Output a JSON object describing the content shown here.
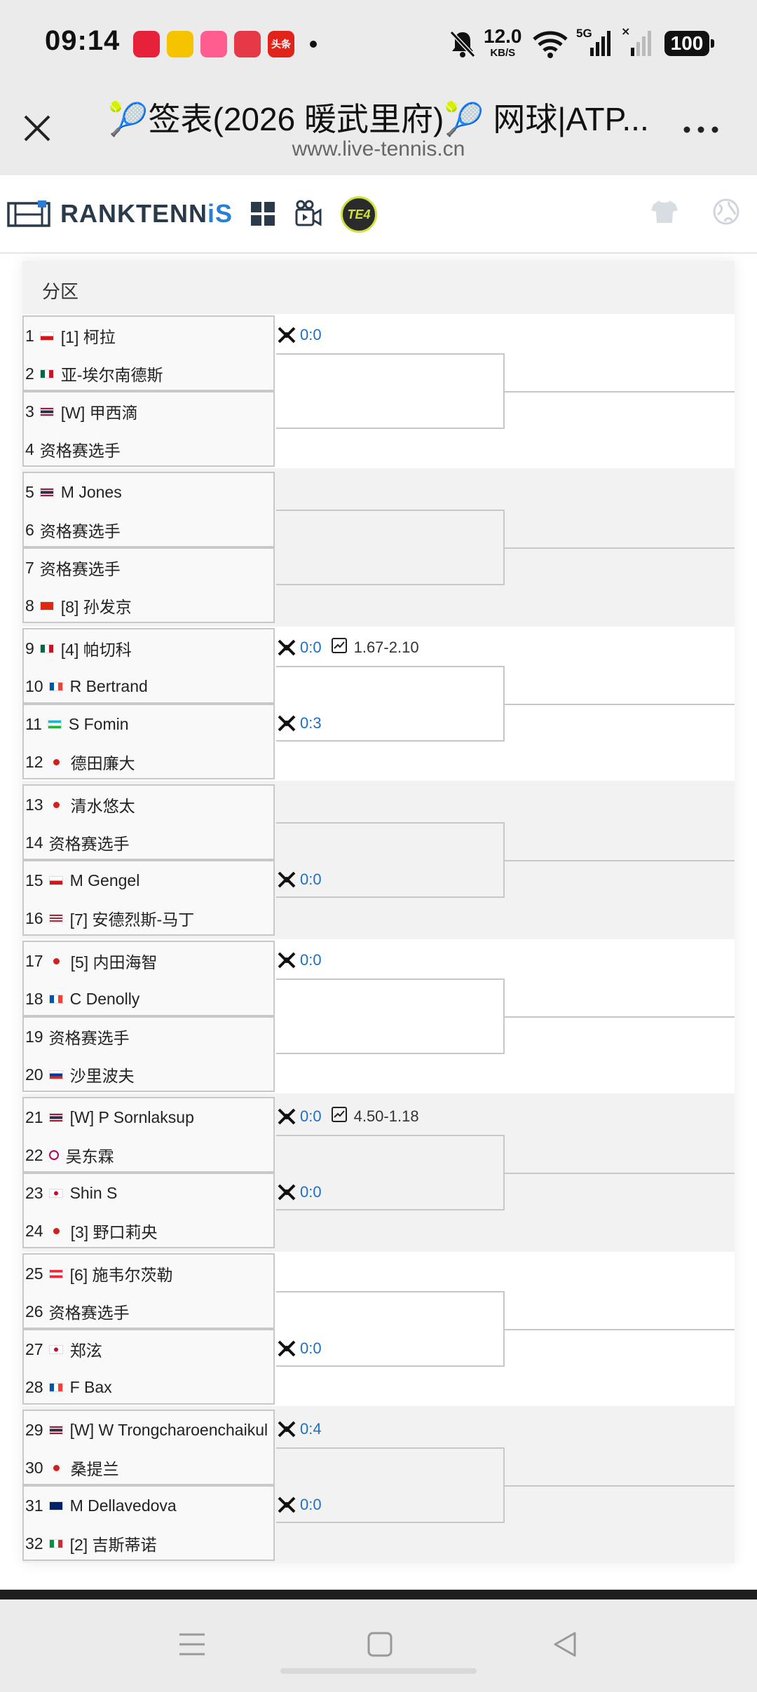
{
  "status_bar": {
    "time": "09:14",
    "net_speed_value": "12.0",
    "net_speed_unit": "KB/S",
    "network_type": "5G",
    "battery": "100",
    "app_icons": [
      {
        "name": "app-icon-red",
        "label": "",
        "color": "#e8213a"
      },
      {
        "name": "weibo-icon",
        "label": "",
        "color": "#f5c400"
      },
      {
        "name": "app-icon-pink",
        "label": "",
        "color": "#ff5d8f"
      },
      {
        "name": "app-icon-mascot",
        "label": "",
        "color": "#e63946"
      },
      {
        "name": "toutiao-icon",
        "label": "头条",
        "color": "#e2231a"
      }
    ]
  },
  "browser": {
    "title": "🎾签表(2026 暖武里府)🎾 网球|ATP...",
    "url": "www.live-tennis.cn"
  },
  "site": {
    "logo_main": "RANKTENN",
    "logo_accent": "iS",
    "badge": "TE4"
  },
  "bracket": {
    "section_label": "分区",
    "players": [
      {
        "num": "1",
        "flag": "cz",
        "name": "[1] 柯拉"
      },
      {
        "num": "2",
        "flag": "mx",
        "name": "亚-埃尔南德斯"
      },
      {
        "num": "3",
        "flag": "th",
        "name": "[W] 甲西滴"
      },
      {
        "num": "4",
        "flag": "",
        "name": "资格赛选手"
      },
      {
        "num": "5",
        "flag": "th",
        "name": "M Jones"
      },
      {
        "num": "6",
        "flag": "",
        "name": "资格赛选手"
      },
      {
        "num": "7",
        "flag": "",
        "name": "资格赛选手"
      },
      {
        "num": "8",
        "flag": "cn",
        "name": "[8] 孙发京"
      },
      {
        "num": "9",
        "flag": "mx",
        "name": "[4] 帕切科"
      },
      {
        "num": "10",
        "flag": "fr",
        "name": "R Bertrand"
      },
      {
        "num": "11",
        "flag": "uz",
        "name": "S Fomin"
      },
      {
        "num": "12",
        "flag": "jp",
        "name": "德田廉大"
      },
      {
        "num": "13",
        "flag": "jp",
        "name": "清水悠太"
      },
      {
        "num": "14",
        "flag": "",
        "name": "资格赛选手"
      },
      {
        "num": "15",
        "flag": "cz",
        "name": "M Gengel"
      },
      {
        "num": "16",
        "flag": "us",
        "name": "[7] 安德烈斯-马丁"
      },
      {
        "num": "17",
        "flag": "jp",
        "name": "[5] 内田海智"
      },
      {
        "num": "18",
        "flag": "fr",
        "name": "C Denolly"
      },
      {
        "num": "19",
        "flag": "",
        "name": "资格赛选手"
      },
      {
        "num": "20",
        "flag": "ru",
        "name": "沙里波夫"
      },
      {
        "num": "21",
        "flag": "th",
        "name": "[W] P Sornlaksup"
      },
      {
        "num": "22",
        "flag": "tw",
        "name": "吴东霖"
      },
      {
        "num": "23",
        "flag": "kr",
        "name": "Shin S"
      },
      {
        "num": "24",
        "flag": "jp",
        "name": "[3] 野口莉央"
      },
      {
        "num": "25",
        "flag": "at",
        "name": "[6] 施韦尔茨勒"
      },
      {
        "num": "26",
        "flag": "",
        "name": "资格赛选手"
      },
      {
        "num": "27",
        "flag": "kr",
        "name": "郑泫"
      },
      {
        "num": "28",
        "flag": "fr",
        "name": "F Bax"
      },
      {
        "num": "29",
        "flag": "th",
        "name": "[W] W Trongcharoenchaikul"
      },
      {
        "num": "30",
        "flag": "jp",
        "name": "桑提兰"
      },
      {
        "num": "31",
        "flag": "au",
        "name": "M Dellavedova"
      },
      {
        "num": "32",
        "flag": "it",
        "name": "[2] 吉斯蒂诺"
      }
    ],
    "matches": [
      {
        "h2h": "0:0",
        "odds": ""
      },
      {
        "h2h": "",
        "odds": ""
      },
      {
        "h2h": "",
        "odds": ""
      },
      {
        "h2h": "",
        "odds": ""
      },
      {
        "h2h": "0:0",
        "odds": "1.67-2.10"
      },
      {
        "h2h": "0:3",
        "odds": ""
      },
      {
        "h2h": "",
        "odds": ""
      },
      {
        "h2h": "0:0",
        "odds": ""
      },
      {
        "h2h": "0:0",
        "odds": ""
      },
      {
        "h2h": "",
        "odds": ""
      },
      {
        "h2h": "0:0",
        "odds": "4.50-1.18"
      },
      {
        "h2h": "0:0",
        "odds": ""
      },
      {
        "h2h": "",
        "odds": ""
      },
      {
        "h2h": "0:0",
        "odds": ""
      },
      {
        "h2h": "0:4",
        "odds": ""
      },
      {
        "h2h": "0:0",
        "odds": ""
      }
    ]
  },
  "colors": {
    "link_blue": "#1f6fc4",
    "logo_dark": "#2b3a4a",
    "logo_accent": "#2a7fd4",
    "badge_lime": "#cfe23b"
  }
}
